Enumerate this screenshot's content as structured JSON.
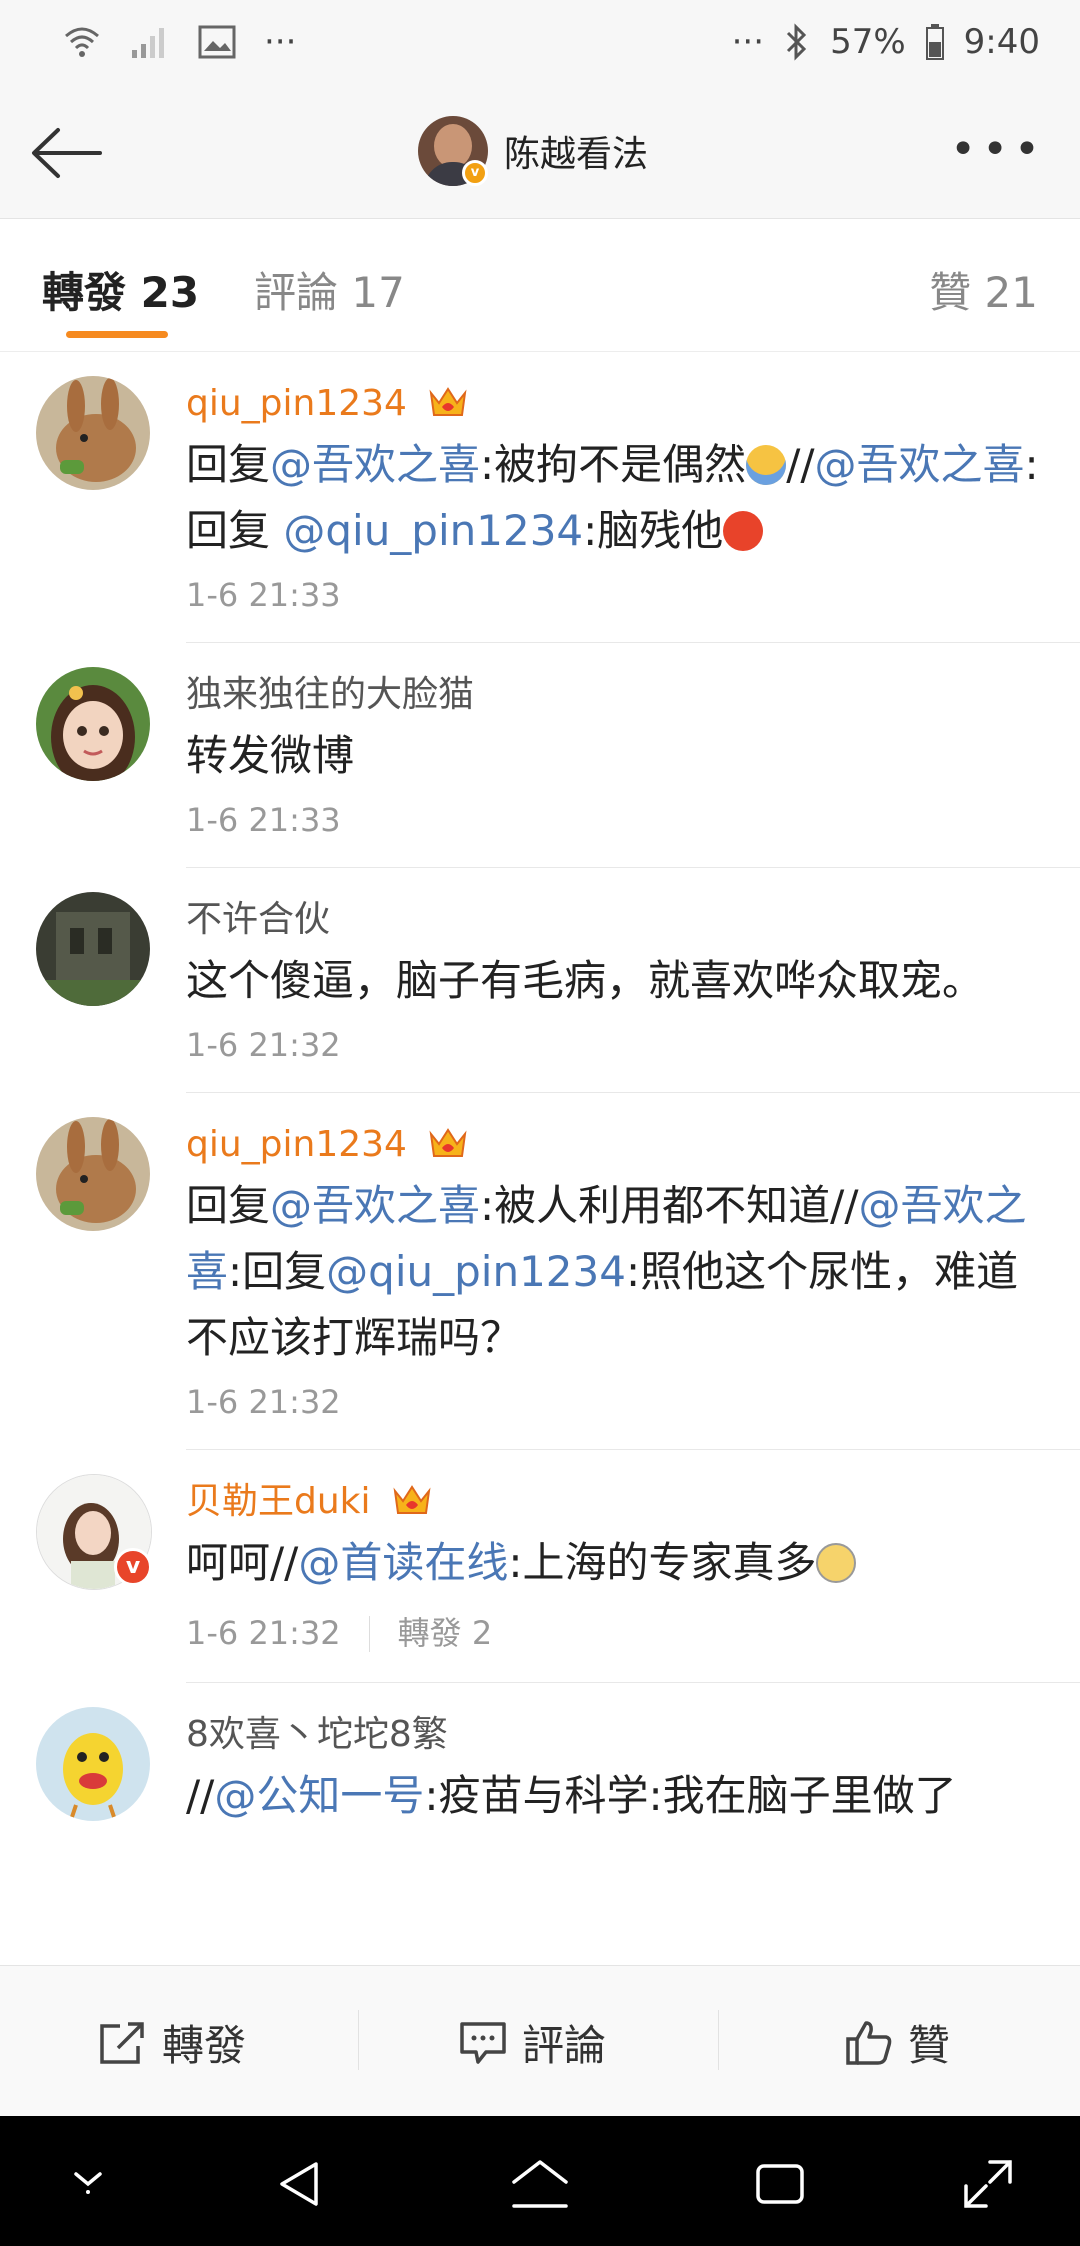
{
  "status_bar": {
    "battery": "57%",
    "time": "9:40",
    "left_dots": "···",
    "right_dots": "···"
  },
  "header": {
    "title": "陈越看法"
  },
  "tabs": {
    "reposts": "轉發 23",
    "comments": "評論 17",
    "likes": "贊 21"
  },
  "items": [
    {
      "user": "qiu_pin1234",
      "parts": [
        "回复",
        "@吾欢之喜",
        ":被拘不是偶然",
        "//",
        "@吾欢之喜",
        ":回复 ",
        "@qiu_pin1234",
        ":脑残他"
      ],
      "time": "1-6 21:33"
    },
    {
      "user": "独来独往的大脸猫",
      "text": "转发微博",
      "time": "1-6 21:33"
    },
    {
      "user": "不许合伙",
      "text": "这个傻逼，脑子有毛病，就喜欢哗众取宠。",
      "time": "1-6 21:32"
    },
    {
      "user": "qiu_pin1234",
      "parts": [
        "回复",
        "@吾欢之喜",
        ":被人利用都不知道//",
        "@吾欢之喜",
        ":回复",
        "@qiu_pin1234",
        ":照他这个尿性，难道不应该打辉瑞吗？"
      ],
      "time": "1-6 21:32"
    },
    {
      "user": "贝勒王duki",
      "parts": [
        "呵呵//",
        "@首读在线",
        ":上海的专家真多"
      ],
      "time": "1-6 21:32",
      "reposts": "轉發 2"
    },
    {
      "user": "8欢喜丶坨坨8繁",
      "parts": [
        "//",
        "@公知一号",
        ":疫苗与科学:我在脑子里做了"
      ]
    }
  ],
  "bottom_bar": {
    "repost": "轉發",
    "comment": "評論",
    "like": "贊"
  },
  "colors": {
    "accent": "#f68a1f",
    "link": "#4a77b5",
    "vip_name": "#ea7a1c"
  }
}
